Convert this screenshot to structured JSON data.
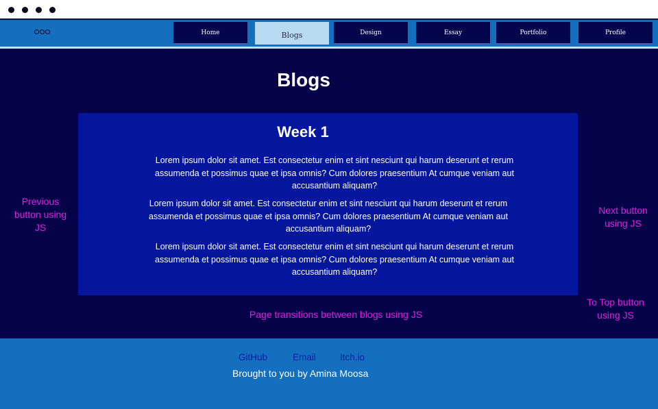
{
  "nav": {
    "items": [
      {
        "label": "Home"
      },
      {
        "label": "Blogs"
      },
      {
        "label": "Design"
      },
      {
        "label": "Essay"
      },
      {
        "label": "Portfolio"
      },
      {
        "label": "Profile"
      }
    ],
    "active": "Blogs"
  },
  "main": {
    "title": "Blogs",
    "card": {
      "title": "Week 1",
      "paragraphs": [
        "Lorem ipsum dolor sit amet. Est consectetur enim et sint nesciunt qui harum deserunt et rerum assumenda et possimus quae et ipsa omnis? Cum dolores praesentium At cumque veniam aut accusantium aliquam?",
        "Lorem ipsum dolor sit amet. Est consectetur enim et sint nesciunt qui harum deserunt et rerum assumenda et possimus quae et ipsa omnis? Cum dolores praesentium At cumque veniam aut accusantium aliquam?",
        "Lorem ipsum dolor sit amet. Est consectetur enim et sint nesciunt qui harum deserunt et rerum assumenda et possimus quae et ipsa omnis? Cum dolores praesentium At cumque veniam aut accusantium aliquam?"
      ]
    },
    "notes": {
      "previous": "Previous button using JS",
      "next": "Next button using JS",
      "to_top": "To Top button using JS",
      "transitions": "Page transitions between blogs using JS"
    }
  },
  "footer": {
    "links": [
      "GitHub",
      "Email",
      "Itch.io"
    ],
    "credit": "Brought to you by Amina Moosa"
  },
  "colors": {
    "nav_bg": "#1470bf",
    "main_bg": "#05024a",
    "card_bg": "#04169e",
    "annotation": "#e21ee0"
  }
}
